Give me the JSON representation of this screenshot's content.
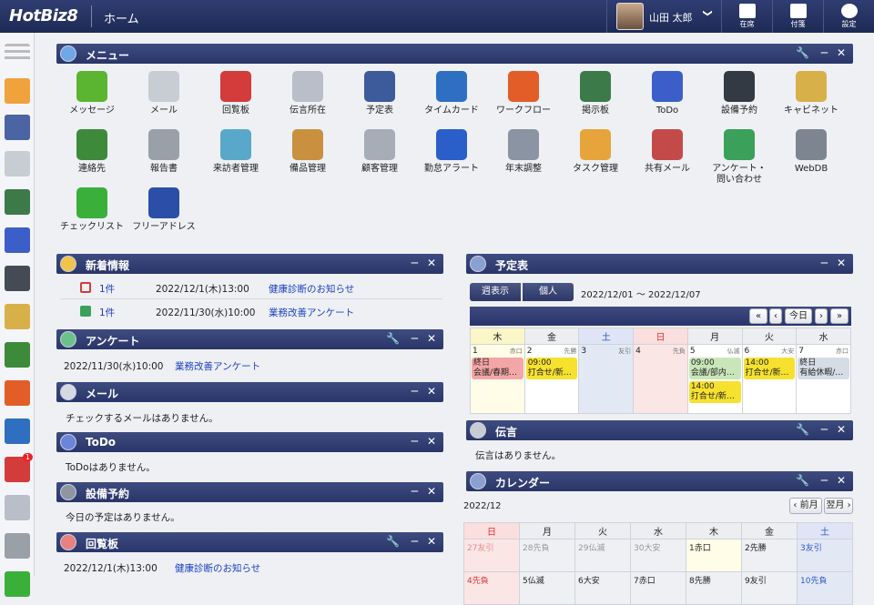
{
  "app": {
    "logo": "HotBiz8",
    "page_title": "ホーム"
  },
  "user": {
    "name": "山田 太郎",
    "chevron": "❯"
  },
  "toolbar": [
    {
      "label": "在席",
      "icon": "presence-icon"
    },
    {
      "label": "付箋",
      "icon": "sticky-note-icon"
    },
    {
      "label": "設定",
      "icon": "gear-icon"
    }
  ],
  "sidebar_icons": [
    "menu-icon",
    "home-icon",
    "calendar-icon",
    "mail-icon",
    "bulletin-icon",
    "todo-icon",
    "projector-icon",
    "cabinet-icon",
    "contacts-icon",
    "workflow-icon",
    "timecard-icon",
    "circular-icon",
    "message-icon",
    "report-icon",
    "checklist-icon"
  ],
  "sidebar_badge": "1",
  "menu_panel": {
    "title": "メニュー",
    "items": [
      {
        "label": "メッセージ",
        "color": "#5cb531"
      },
      {
        "label": "メール",
        "color": "#c8ccd3"
      },
      {
        "label": "回覧板",
        "color": "#d43b3b"
      },
      {
        "label": "伝言所在",
        "color": "#b9bec8"
      },
      {
        "label": "予定表",
        "color": "#3d5a9a"
      },
      {
        "label": "タイムカード",
        "color": "#2f6fc2"
      },
      {
        "label": "ワークフロー",
        "color": "#e25d28"
      },
      {
        "label": "掲示板",
        "color": "#3c7a4a"
      },
      {
        "label": "ToDo",
        "color": "#3b5ec8"
      },
      {
        "label": "設備予約",
        "color": "#333a44"
      },
      {
        "label": "キャビネット",
        "color": "#d7b04a"
      },
      {
        "label": "連絡先",
        "color": "#3d8a3a"
      },
      {
        "label": "報告書",
        "color": "#9aa0a8"
      },
      {
        "label": "来訪者管理",
        "color": "#59a8c9"
      },
      {
        "label": "備品管理",
        "color": "#c9903f"
      },
      {
        "label": "顧客管理",
        "color": "#a7adb6"
      },
      {
        "label": "勤怠アラート",
        "color": "#2a5fc9"
      },
      {
        "label": "年末調整",
        "color": "#8a94a3"
      },
      {
        "label": "タスク管理",
        "color": "#e7a43a"
      },
      {
        "label": "共有メール",
        "color": "#c44a4a"
      },
      {
        "label": "アンケート・\n問い合わせ",
        "color": "#3aa05a"
      },
      {
        "label": "WebDB",
        "color": "#7d8590"
      },
      {
        "label": "チェックリスト",
        "color": "#3ab03a"
      },
      {
        "label": "フリーアドレス",
        "color": "#2b4fa8"
      }
    ]
  },
  "news_panel": {
    "title": "新着情報",
    "rows": [
      {
        "count": "1件",
        "date": "2022/12/1(木)13:00",
        "subject": "健康診断のお知らせ"
      },
      {
        "count": "1件",
        "date": "2022/11/30(水)10:00",
        "subject": "業務改善アンケート"
      }
    ]
  },
  "survey_panel": {
    "title": "アンケート",
    "date": "2022/11/30(水)10:00",
    "subject": "業務改善アンケート"
  },
  "mail_panel": {
    "title": "メール",
    "message": "チェックするメールはありません。"
  },
  "todo_panel": {
    "title": "ToDo",
    "message": "ToDoはありません。"
  },
  "equip_panel": {
    "title": "設備予約",
    "message": "今日の予定はありません。"
  },
  "circular_panel": {
    "title": "回覧板",
    "date": "2022/12/1(木)13:00",
    "subject": "健康診断のお知らせ"
  },
  "schedule_panel": {
    "title": "予定表",
    "toggle_week": "週表示",
    "toggle_personal": "個人",
    "range": "2022/12/01 〜 2022/12/07",
    "nav": {
      "first": "«",
      "prev": "‹",
      "today": "今日",
      "next": "›",
      "last": "»"
    },
    "weekdays": [
      "木",
      "金",
      "土",
      "日",
      "月",
      "火",
      "水"
    ],
    "days": [
      {
        "num": "1",
        "rokuyo": "赤口",
        "events": [
          {
            "text": "終日\n会議/春期…",
            "color": "#f3a6a6"
          }
        ]
      },
      {
        "num": "2",
        "rokuyo": "先勝",
        "events": [
          {
            "text": "09:00\n打合せ/新…",
            "color": "#f6e12f"
          }
        ]
      },
      {
        "num": "3",
        "rokuyo": "友引",
        "events": []
      },
      {
        "num": "4",
        "rokuyo": "先負",
        "events": []
      },
      {
        "num": "5",
        "rokuyo": "仏滅",
        "events": [
          {
            "text": "09:00\n会議/部内…",
            "color": "#c9e6b9"
          },
          {
            "text": "14:00\n打合せ/新…",
            "color": "#f6e12f"
          }
        ]
      },
      {
        "num": "6",
        "rokuyo": "大安",
        "events": [
          {
            "text": "14:00\n打合せ/新…",
            "color": "#f6e12f"
          }
        ]
      },
      {
        "num": "7",
        "rokuyo": "赤口",
        "events": [
          {
            "text": "終日\n有給休暇/…",
            "color": "#d5dce6"
          }
        ]
      }
    ]
  },
  "message_panel": {
    "title": "伝言",
    "message": "伝言はありません。"
  },
  "calendar_panel": {
    "title": "カレンダー",
    "month": "2022/12",
    "prev": "‹ 前月",
    "next": "翌月 ›",
    "weekdays": [
      "日",
      "月",
      "火",
      "水",
      "木",
      "金",
      "土"
    ],
    "row1": [
      "27友引",
      "28先負",
      "29仏滅",
      "30大安",
      "1赤口",
      "2先勝",
      "3友引"
    ],
    "row2": [
      "4先負",
      "5仏滅",
      "6大安",
      "7赤口",
      "8先勝",
      "9友引",
      "10先負"
    ]
  }
}
